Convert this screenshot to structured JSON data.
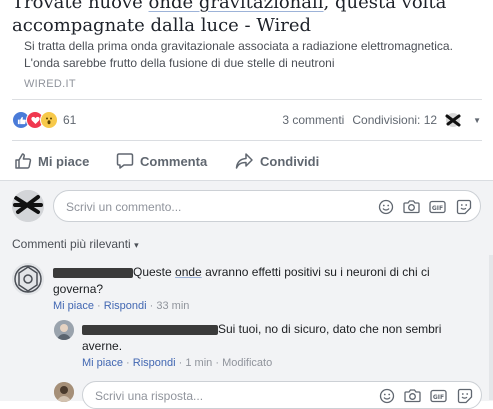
{
  "preview": {
    "title_pre": "Trovate nuove ",
    "title_hl": "onde gravitazionali",
    "title_post": ", questa volta",
    "title_line2": "accompagnate dalla luce - Wired",
    "description": "Si tratta della prima onda gravitazionale associata a radiazione elettromagnetica. L'onda sarebbe frutto della fusione di due stelle di neutroni",
    "domain": "WIRED.IT"
  },
  "stats": {
    "reaction_count": "61",
    "comments": "3 commenti",
    "shares": "Condivisioni: 12"
  },
  "actions": {
    "like": "Mi piace",
    "comment": "Commenta",
    "share": "Condividi"
  },
  "composer": {
    "placeholder": "Scrivi un commento..."
  },
  "filter": {
    "label": "Commenti più rilevanti",
    "caret": "▾"
  },
  "comment1": {
    "text_pre": "Queste ",
    "text_hl": "onde",
    "text_post": " avranno effetti positivi su i neuroni di chi ci governa?",
    "like": "Mi piace",
    "reply": "Rispondi",
    "time": "33 min"
  },
  "reply1": {
    "text": "Sui tuoi, no di sicuro, dato che non sembri averne.",
    "like": "Mi piace",
    "reply": "Rispondi",
    "time": "1 min",
    "edited": "Modificato"
  },
  "reply_composer": {
    "placeholder": "Scrivi una risposta..."
  },
  "icons": [
    "like-reaction-icon",
    "love-reaction-icon",
    "wow-reaction-icon",
    "thumbs-up-icon",
    "speech-bubble-icon",
    "share-arrow-icon",
    "emoji-icon",
    "camera-icon",
    "gif-icon",
    "sticker-icon"
  ]
}
